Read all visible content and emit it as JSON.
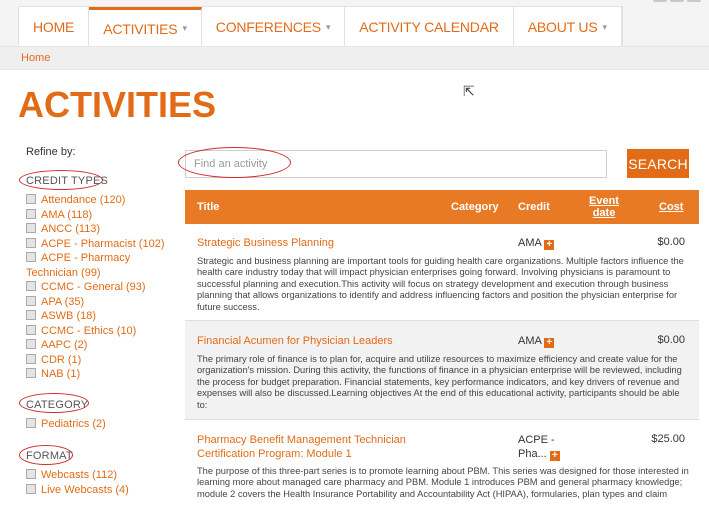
{
  "nav": {
    "items": [
      {
        "label": "HOME",
        "caret": ""
      },
      {
        "label": "ACTIVITIES",
        "caret": "▾"
      },
      {
        "label": "CONFERENCES",
        "caret": "▾"
      },
      {
        "label": "ACTIVITY CALENDAR",
        "caret": ""
      },
      {
        "label": "ABOUT US",
        "caret": "▾"
      }
    ],
    "active_index": 1
  },
  "breadcrumb": {
    "home": "Home"
  },
  "page_title": "ACTIVITIES",
  "sidebar": {
    "refine_label": "Refine by:",
    "credit_types": {
      "heading": "CREDIT TYPES",
      "items": [
        "Attendance (120)",
        "AMA (118)",
        "ANCC (113)",
        "ACPE - Pharmacist (102)",
        "ACPE - Pharmacy Technician (99)",
        "CCMC - General (93)",
        "APA (35)",
        "ASWB (18)",
        "CCMC - Ethics (10)",
        "AAPC (2)",
        "CDR (1)",
        "NAB (1)"
      ]
    },
    "category": {
      "heading": "CATEGORY",
      "items": [
        "Pediatrics (2)"
      ]
    },
    "format": {
      "heading": "FORMAT",
      "items": [
        "Webcasts (112)",
        "Live Webcasts (4)"
      ]
    }
  },
  "search": {
    "placeholder": "Find an activity",
    "button_label": "SEARCH"
  },
  "table": {
    "headers": {
      "title": "Title",
      "category": "Category",
      "credit": "Credit",
      "event_date": "Event date",
      "cost": "Cost"
    },
    "rows": [
      {
        "title": "Strategic Business Planning",
        "credit": "AMA",
        "cost": "$0.00",
        "description": "Strategic and business planning are important tools for guiding health care organizations. Multiple factors influence the health care industry today that will impact physician enterprises going forward. Involving physicians is paramount to successful planning and execution.This activity will focus on strategy development and execution through business planning that allows organizations to identify and address influencing factors and position the physician enterprise for future success."
      },
      {
        "title": "Financial Acumen for Physician Leaders",
        "credit": "AMA",
        "cost": "$0.00",
        "description": "The primary role of finance is to plan for, acquire and utilize resources to maximize efficiency and create value for the organization's mission. During this activity, the functions of finance in a physician enterprise will be reviewed, including the process for budget preparation. Financial statements, key performance indicators, and key drivers of revenue and expenses will also be discussed.Learning objectives At the end of this educational activity, participants should be able to:"
      },
      {
        "title": "Pharmacy Benefit Management Technician Certification Program: Module 1",
        "credit": "ACPE - Pha...",
        "cost": "$25.00",
        "description": "The purpose of this three-part series is to promote learning about PBM. This series was designed for those interested in learning more about managed care pharmacy and PBM. Module 1 introduces PBM and general pharmacy knowledge; module 2 covers the Health Insurance Portability and Accountability Act (HIPAA), formularies, plan types and claim"
      }
    ]
  },
  "colors": {
    "accent": "#e26b17",
    "header_bar": "#e87a25",
    "annotation_ring": "#d22b2b"
  }
}
